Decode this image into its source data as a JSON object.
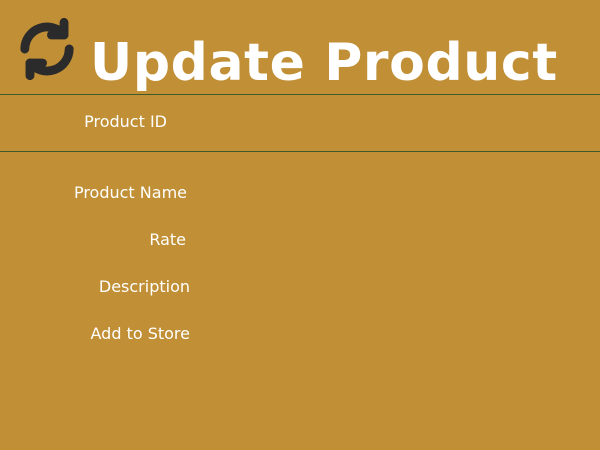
{
  "header": {
    "title": "Update Product",
    "icon": "refresh-icon"
  },
  "form": {
    "product_id_label": "Product ID",
    "product_name_label": "Product Name",
    "rate_label": "Rate",
    "description_label": "Description",
    "add_to_store_label": "Add to Store",
    "product_id_value": "",
    "product_name_value": "",
    "rate_value": "",
    "description_value": "",
    "add_to_store_value": ""
  },
  "colors": {
    "background": "#c18f35",
    "text": "#ffffff",
    "icon": "#2b2b2b",
    "divider": "#3d5a2a"
  }
}
